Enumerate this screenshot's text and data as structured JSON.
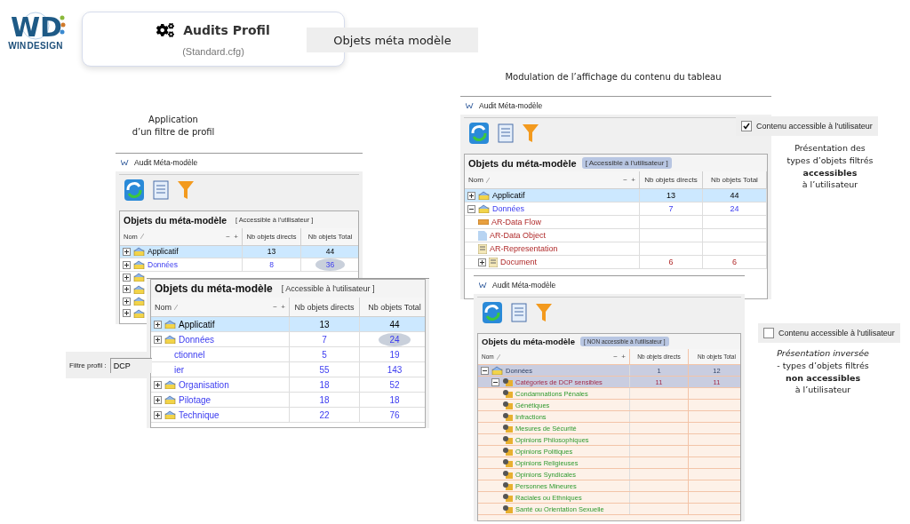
{
  "header": {
    "logo": {
      "mark": "WD",
      "name": [
        "WIN",
        "DESIGN"
      ]
    },
    "card": {
      "title": "Audits Profil",
      "subtitle": "(Standard.cfg)"
    },
    "section_label": "Objets méta modèle"
  },
  "captions": {
    "left": "Application\nd’un filtre de profil",
    "top": "Modulation de l’affichage du contenu du tableau"
  },
  "panels": [
    {
      "kind": "window",
      "title": "Audit Méta-modèle",
      "table": {
        "heading": "Objets du méta-modèle",
        "tag": "[ Accessible à l'utilisateur ]",
        "tag_highlighted": false,
        "tree_controls": "−  +",
        "columns": [
          "Nom",
          "Nb objets directs",
          "Nb objets Total"
        ],
        "rows": [
          {
            "name": "Applicatif",
            "direct": "13",
            "total": "44",
            "kind": "root",
            "expanded": false,
            "selected": true,
            "circled": false
          },
          {
            "name": "Données",
            "direct": "8",
            "total": "36",
            "kind": "domain",
            "expanded": false,
            "selected": false,
            "circled": true
          },
          {
            "kind": "stub",
            "expanded": false
          },
          {
            "kind": "stub",
            "expanded": false
          },
          {
            "kind": "stub",
            "expanded": false
          },
          {
            "kind": "stub",
            "expanded": false
          }
        ]
      }
    },
    {
      "kind": "table_only",
      "table": {
        "heading": "Objets du méta-modèle",
        "tag": "[ Accessible à l'utilisateur ]",
        "tag_highlighted": false,
        "tree_controls": "−  +",
        "columns": [
          "Nom",
          "Nb objets directs",
          "Nb objets Total"
        ],
        "rows": [
          {
            "name": "Applicatif",
            "direct": "13",
            "total": "44",
            "kind": "root",
            "expanded": false,
            "selected": true,
            "circled": false
          },
          {
            "name": "Données",
            "direct": "7",
            "total": "24",
            "kind": "domain",
            "expanded": false,
            "selected": false,
            "circled": true
          },
          {
            "name": "ctionnel",
            "direct": "5",
            "total": "19",
            "kind": "cut",
            "selected": false,
            "circled": false
          },
          {
            "name": "ier",
            "direct": "55",
            "total": "143",
            "kind": "cut",
            "selected": false,
            "circled": false
          },
          {
            "name": "Organisation",
            "direct": "18",
            "total": "52",
            "kind": "domain",
            "expanded": false,
            "selected": false,
            "circled": false
          },
          {
            "name": "Pilotage",
            "direct": "18",
            "total": "18",
            "kind": "domain",
            "expanded": false,
            "selected": false,
            "circled": false
          },
          {
            "name": "Technique",
            "direct": "22",
            "total": "76",
            "kind": "domain",
            "expanded": false,
            "selected": false,
            "circled": false
          }
        ]
      }
    },
    {
      "kind": "window",
      "title": "Audit Méta-modèle",
      "table": {
        "heading": "Objets du méta-modèle",
        "tag": "[ Accessible à l'utilisateur ]",
        "tag_highlighted": true,
        "tree_controls": "−  +",
        "columns": [
          "Nom",
          "Nb objets directs",
          "Nb objets Total"
        ],
        "rows": [
          {
            "name": "Applicatif",
            "direct": "13",
            "total": "44",
            "kind": "root",
            "expanded": false,
            "selected": true
          },
          {
            "name": "Données",
            "direct": "7",
            "total": "24",
            "kind": "domain",
            "expanded": true,
            "selected": false,
            "children": [
              {
                "name": "AR-Data Flow",
                "kind": "flow",
                "selected": false
              },
              {
                "name": "AR-Data Object",
                "kind": "object",
                "selected": false
              },
              {
                "name": "AR-Representation",
                "kind": "doc",
                "selected": false
              },
              {
                "name": "Document",
                "direct": "6",
                "total": "6",
                "kind": "doc",
                "expanded": false,
                "selected": false
              }
            ]
          }
        ]
      }
    },
    {
      "kind": "window",
      "title": "Audit Méta-modèle",
      "table": {
        "heading": "Objets du méta-modèle",
        "tag": "[ NON accessible à l'utilisateur ]",
        "tag_highlighted": true,
        "tree_controls": "−  +",
        "columns": [
          "Nom",
          "Nb objets directs",
          "Nb objets Total"
        ],
        "rows": [
          {
            "name": "Données",
            "direct": "1",
            "total": "12",
            "kind": "group",
            "expanded": true,
            "selected": true,
            "children": [
              {
                "name": "Catégories de DCP sensibles",
                "direct": "11",
                "total": "11",
                "kind": "sensitive",
                "expanded": true,
                "selected": true,
                "children": [
                  {
                    "name": "Condamnations Pénales",
                    "kind": "category",
                    "selected": false
                  },
                  {
                    "name": "Génétiques",
                    "kind": "category",
                    "selected": false
                  },
                  {
                    "name": "Infractions",
                    "kind": "category",
                    "selected": false
                  },
                  {
                    "name": "Mesures de Sécurité",
                    "kind": "category",
                    "selected": false
                  },
                  {
                    "name": "Opinions Philosophiques",
                    "kind": "category",
                    "selected": false
                  },
                  {
                    "name": "Opinions Politiques",
                    "kind": "category",
                    "selected": false
                  },
                  {
                    "name": "Opinions Religieuses",
                    "kind": "category",
                    "selected": false
                  },
                  {
                    "name": "Opinions Syndicales",
                    "kind": "category",
                    "selected": false
                  },
                  {
                    "name": "Personnes Mineures",
                    "kind": "category",
                    "selected": false
                  },
                  {
                    "name": "Raciales ou Ethniques",
                    "kind": "category",
                    "selected": false
                  },
                  {
                    "name": "Santé ou Orientation Sexuelle",
                    "kind": "category",
                    "selected": false
                  }
                ]
              }
            ]
          }
        ]
      }
    }
  ],
  "filter": {
    "label": "Filtre profil :",
    "value": "DCP"
  },
  "toggles": [
    {
      "label": "Contenu accessible à l'utilisateur",
      "checked": true
    },
    {
      "label": "Contenu accessible à l'utilisateur",
      "checked": false
    }
  ],
  "notes": [
    "Présentation des\ntypes d’objets filtrés\n**accessibles**\nà l’utilisateur",
    "*Présentation inversée*\n- types d’objets filtrés\n**non accessibles**\nà l’utilisateur"
  ]
}
